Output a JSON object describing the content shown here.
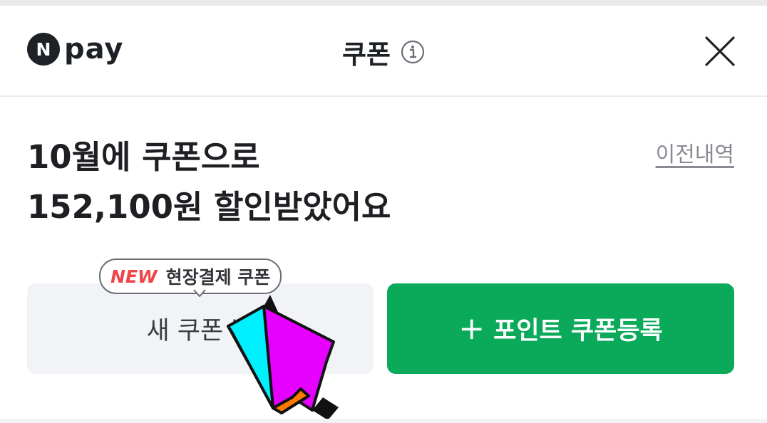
{
  "header": {
    "logo_mark": "N",
    "logo_text": "pay",
    "title": "쿠폰",
    "info_icon": "info-icon",
    "close_icon": "close-icon"
  },
  "summary": {
    "line1": "10월에 쿠폰으로",
    "line2": "152,100원 할인받았어요",
    "history_link": "이전내역"
  },
  "actions": {
    "new_coupon_label": "새 쿠폰 받",
    "register_label": "포인트 쿠폰등록",
    "register_icon": "+",
    "tooltip_badge": "NEW",
    "tooltip_text": "현장결제 쿠폰"
  },
  "overlay": {
    "pointer_icon": "pointer-arrow-icon"
  },
  "colors": {
    "accent_green": "#0aaa5a",
    "new_red": "#f0444b",
    "arrow_magenta": "#e600ff",
    "arrow_cyan": "#00f0ff",
    "arrow_orange": "#ff7a00"
  }
}
